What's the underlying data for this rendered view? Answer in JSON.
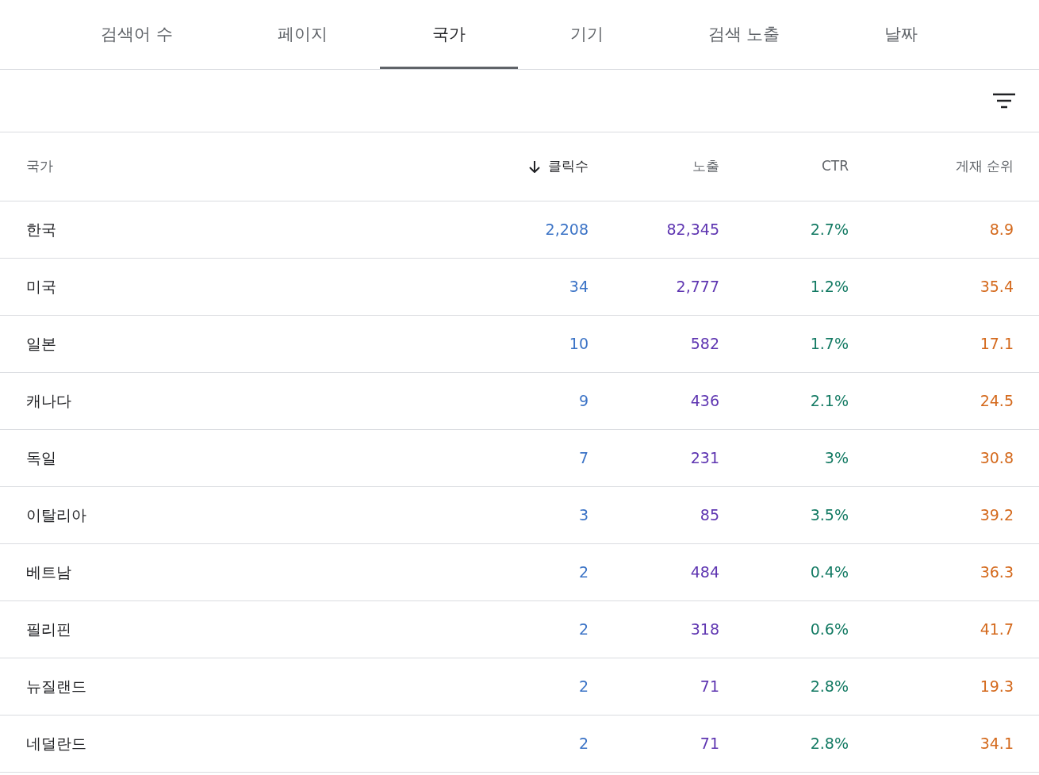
{
  "tabs": [
    {
      "label": "검색어 수",
      "selected": false
    },
    {
      "label": "페이지",
      "selected": false
    },
    {
      "label": "국가",
      "selected": true
    },
    {
      "label": "기기",
      "selected": false
    },
    {
      "label": "검색 노출",
      "selected": false
    },
    {
      "label": "날짜",
      "selected": false
    }
  ],
  "table": {
    "columns": [
      {
        "label": "국가",
        "sorted": false,
        "color": "#202124"
      },
      {
        "label": "클릭수",
        "sorted": true,
        "color": "#3b73c6"
      },
      {
        "label": "노출",
        "sorted": false,
        "color": "#5e35b1"
      },
      {
        "label": "CTR",
        "sorted": false,
        "color": "#137a63"
      },
      {
        "label": "게재 순위",
        "sorted": false,
        "color": "#d4691c"
      }
    ],
    "rows": [
      [
        "한국",
        "2,208",
        "82,345",
        "2.7%",
        "8.9"
      ],
      [
        "미국",
        "34",
        "2,777",
        "1.2%",
        "35.4"
      ],
      [
        "일본",
        "10",
        "582",
        "1.7%",
        "17.1"
      ],
      [
        "캐나다",
        "9",
        "436",
        "2.1%",
        "24.5"
      ],
      [
        "독일",
        "7",
        "231",
        "3%",
        "30.8"
      ],
      [
        "이탈리아",
        "3",
        "85",
        "3.5%",
        "39.2"
      ],
      [
        "베트남",
        "2",
        "484",
        "0.4%",
        "36.3"
      ],
      [
        "필리핀",
        "2",
        "318",
        "0.6%",
        "41.7"
      ],
      [
        "뉴질랜드",
        "2",
        "71",
        "2.8%",
        "19.3"
      ],
      [
        "네덜란드",
        "2",
        "71",
        "2.8%",
        "34.1"
      ]
    ]
  }
}
